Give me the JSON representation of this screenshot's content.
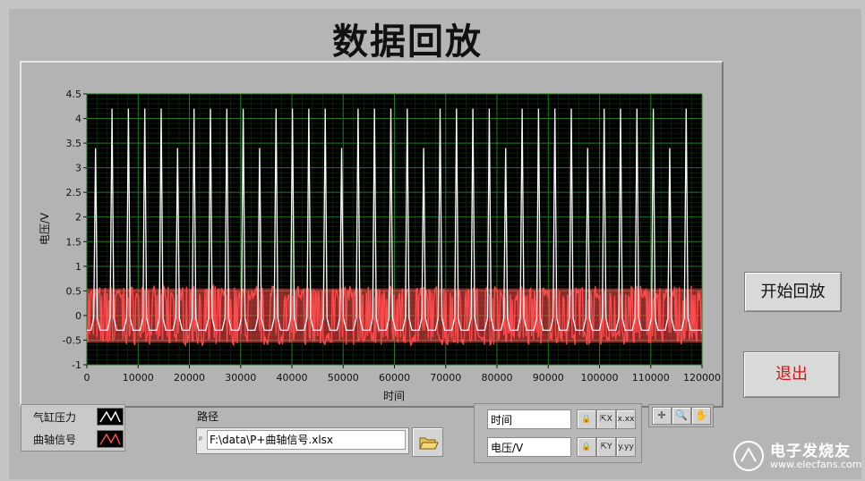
{
  "window": {
    "title": "数据回放"
  },
  "graph": {
    "y_axis_label": "电压/V",
    "x_axis_label": "时间",
    "y_ticks": [
      "4.5",
      "4",
      "3.5",
      "3",
      "2.5",
      "2",
      "1.5",
      "1",
      "0.5",
      "0",
      "-0.5",
      "-1"
    ],
    "x_ticks": [
      "0",
      "10000",
      "20000",
      "30000",
      "40000",
      "50000",
      "60000",
      "70000",
      "80000",
      "90000",
      "100000",
      "110000",
      "120000"
    ]
  },
  "chart_data": {
    "type": "line",
    "xlim": [
      0,
      120000
    ],
    "ylim": [
      -1,
      4.5
    ],
    "xlabel": "时间",
    "ylabel": "电压/V",
    "grid": true,
    "series": [
      {
        "name": "气缸压力",
        "color": "#ffffff",
        "description_values": {
          "baseline": -0.3,
          "peak": 4.2,
          "pulse_count": 37,
          "first_pulse_x": 1700,
          "pulse_period": 3200
        }
      },
      {
        "name": "曲轴信号",
        "color": "#ff4d4d",
        "description_values": {
          "min": -0.6,
          "max": 0.6
        }
      }
    ]
  },
  "legend": {
    "items": [
      {
        "label": "气缸压力",
        "color": "#ffffff"
      },
      {
        "label": "曲轴信号",
        "color": "#ff4d4d"
      }
    ]
  },
  "buttons": {
    "start_replay": "开始回放",
    "exit": "退出"
  },
  "path_control": {
    "label": "路径",
    "value": "F:\\data\\P+曲轴信号.xlsx"
  },
  "axis_scale": {
    "x_name": "时间",
    "y_name": "电压/V"
  },
  "watermark": {
    "main": "电子发烧友",
    "sub": "www.elecfans.com"
  },
  "colors": {
    "plot_bg": "#000000",
    "grid": "#1f7a1f",
    "exit_text": "#e01010"
  }
}
